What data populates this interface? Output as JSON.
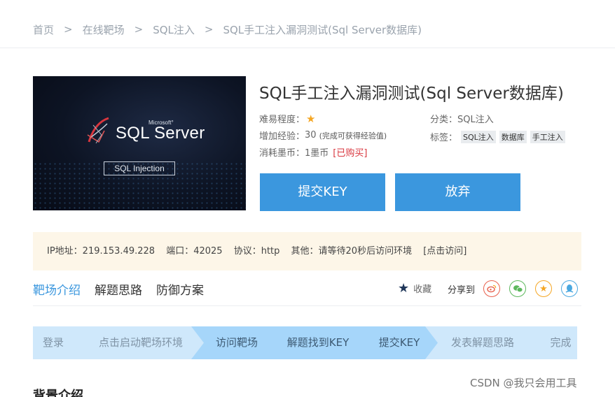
{
  "breadcrumb": {
    "items": [
      "首页",
      "在线靶场",
      "SQL注入",
      "SQL手工注入漏洞测试(Sql Server数据库)"
    ],
    "separator": ">"
  },
  "cover": {
    "microsoft": "Microsoft°",
    "brand": "SQL Server",
    "tag": "SQL Injection"
  },
  "title": "SQL手工注入漏洞测试(Sql Server数据库)",
  "meta": {
    "difficulty_label": "难易程度：",
    "difficulty_stars": 1,
    "exp_label": "增加经验：",
    "exp_value": "30",
    "exp_note": "(完成可获得经验值)",
    "cost_label": "消耗墨币：",
    "cost_value": "1墨币",
    "bought": "[已购买]",
    "category_label": "分类：",
    "category_value": "SQL注入",
    "tags_label": "标签：",
    "tags": [
      "SQL注入",
      "数据库",
      "手工注入"
    ]
  },
  "buttons": {
    "submit": "提交KEY",
    "give_up": "放弃"
  },
  "info": {
    "ip": "IP地址：219.153.49.228",
    "port": "端口：42025",
    "protocol": "协议：http",
    "other": "其他：请等待20秒后访问环境",
    "link": "[点击访问]"
  },
  "tabs": [
    "靶场介绍",
    "解题思路",
    "防御方案"
  ],
  "fav_label": "收藏",
  "share_label": "分享到",
  "share_icons": [
    "weibo-icon",
    "wechat-icon",
    "qzone-icon",
    "qq-icon"
  ],
  "colors": {
    "accent": "#3b97de",
    "info_bg": "#fdf6e8",
    "bought": "#d9363e",
    "star": "#f5a623"
  },
  "steps": [
    "登录",
    "点击启动靶场环境",
    "访问靶场",
    "解题找到KEY",
    "提交KEY",
    "发表解题思路",
    "完成"
  ],
  "section_title": "背景介绍",
  "watermark": "CSDN @我只会用工具"
}
